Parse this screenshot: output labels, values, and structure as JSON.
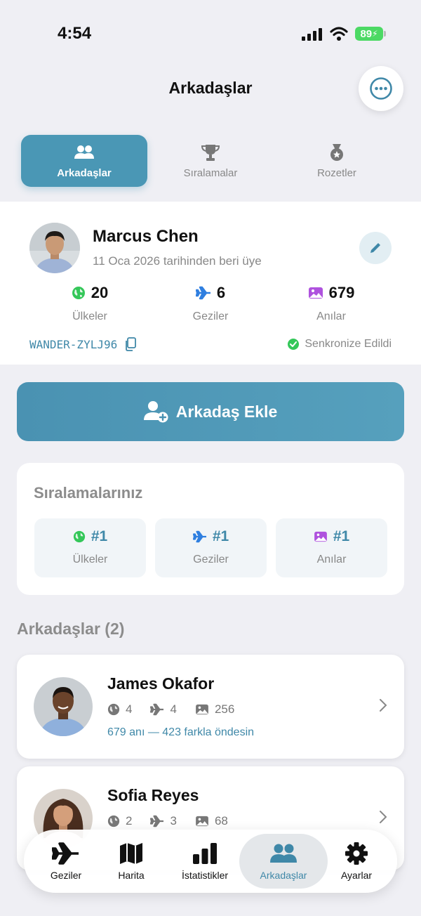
{
  "status_bar": {
    "time": "4:54",
    "battery": "89"
  },
  "nav": {
    "title": "Arkadaşlar"
  },
  "segments": [
    {
      "label": "Arkadaşlar",
      "icon": "people-icon"
    },
    {
      "label": "Sıralamalar",
      "icon": "trophy-icon"
    },
    {
      "label": "Rozetler",
      "icon": "medal-icon"
    }
  ],
  "profile": {
    "name": "Marcus Chen",
    "since": "11 Oca 2026 tarihinden beri üye",
    "stats": [
      {
        "value": "20",
        "label": "Ülkeler",
        "icon": "globe-icon"
      },
      {
        "value": "6",
        "label": "Geziler",
        "icon": "airplane-icon"
      },
      {
        "value": "679",
        "label": "Anılar",
        "icon": "photo-icon"
      }
    ],
    "friend_code": "WANDER-ZYLJ96",
    "sync_status": "Senkronize Edildi"
  },
  "add_friend": {
    "label": "Arkadaş Ekle"
  },
  "rankings": {
    "title": "Sıralamalarınız",
    "items": [
      {
        "value": "#1",
        "label": "Ülkeler"
      },
      {
        "value": "#1",
        "label": "Geziler"
      },
      {
        "value": "#1",
        "label": "Anılar"
      }
    ]
  },
  "friends": {
    "header": "Arkadaşlar (2)",
    "items": [
      {
        "name": "James Okafor",
        "countries": "4",
        "trips": "4",
        "memories": "256",
        "compare": "679 anı — 423 farkla öndesin"
      },
      {
        "name": "Sofia Reyes",
        "countries": "2",
        "trips": "3",
        "memories": "68",
        "compare": ""
      }
    ]
  },
  "tab_bar": {
    "items": [
      {
        "label": "Geziler",
        "icon": "airplane-icon"
      },
      {
        "label": "Harita",
        "icon": "map-icon"
      },
      {
        "label": "İstatistikler",
        "icon": "bar-chart-icon"
      },
      {
        "label": "Arkadaşlar",
        "icon": "people-icon"
      },
      {
        "label": "Ayarlar",
        "icon": "gear-icon"
      }
    ]
  },
  "colors": {
    "accent": "#4a97b5",
    "accent_text": "#3f88a8",
    "globe": "#34c759",
    "airplane": "#2f7fe0",
    "photo": "#af52de"
  }
}
